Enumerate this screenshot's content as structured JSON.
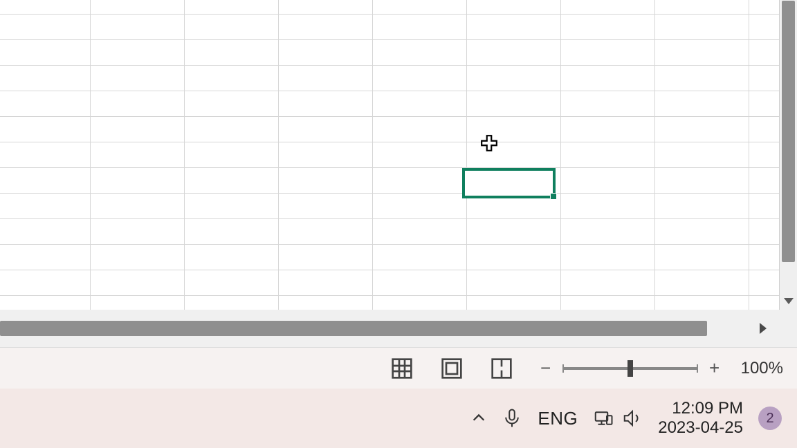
{
  "grid": {
    "columns": 9,
    "rows": 12,
    "selected_cell": {
      "col": 5,
      "row": 7,
      "value": ""
    },
    "cursor": "plus"
  },
  "status_bar": {
    "view_modes": [
      "normal",
      "page-layout",
      "page-break"
    ],
    "active_view": "normal",
    "zoom": {
      "value": 100,
      "label": "100%",
      "min": 10,
      "max": 400
    }
  },
  "taskbar": {
    "hidden_icons_label": "Show hidden icons",
    "mic_label": "Voice input",
    "input_language": "ENG",
    "network_label": "Network",
    "volume_label": "Volume",
    "clock": {
      "time": "12:09 PM",
      "date": "2023-04-25"
    },
    "notification_count": "2"
  }
}
